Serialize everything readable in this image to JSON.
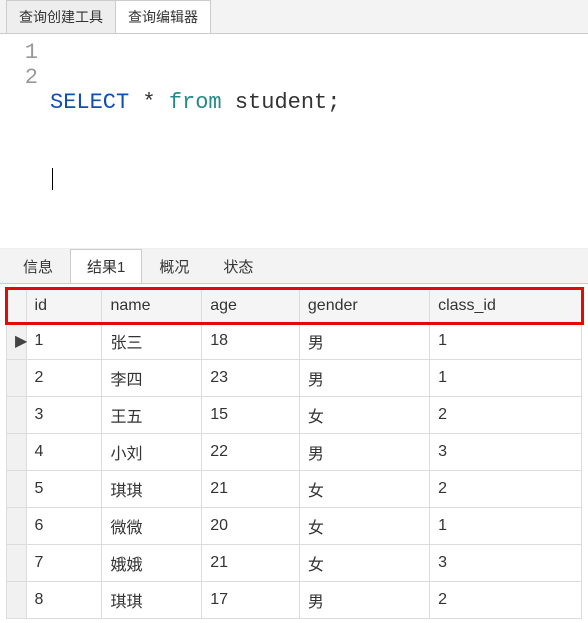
{
  "top_tabs": {
    "create": "查询创建工具",
    "editor": "查询编辑器"
  },
  "code": {
    "line1_num": "1",
    "line2_num": "2",
    "kw_select": "SELECT",
    "star": " * ",
    "kw_from": "from",
    "ident": " student;"
  },
  "result_tabs": {
    "info": "信息",
    "result1": "结果1",
    "profile": "概况",
    "status": "状态"
  },
  "columns": {
    "id": "id",
    "name": "name",
    "age": "age",
    "gender": "gender",
    "class_id": "class_id"
  },
  "rows": [
    {
      "marker": "▶",
      "id": "1",
      "name": "张三",
      "age": "18",
      "gender": "男",
      "class_id": "1"
    },
    {
      "marker": "",
      "id": "2",
      "name": "李四",
      "age": "23",
      "gender": "男",
      "class_id": "1"
    },
    {
      "marker": "",
      "id": "3",
      "name": "王五",
      "age": "15",
      "gender": "女",
      "class_id": "2"
    },
    {
      "marker": "",
      "id": "4",
      "name": "小刘",
      "age": "22",
      "gender": "男",
      "class_id": "3"
    },
    {
      "marker": "",
      "id": "5",
      "name": "琪琪",
      "age": "21",
      "gender": "女",
      "class_id": "2"
    },
    {
      "marker": "",
      "id": "6",
      "name": "微微",
      "age": "20",
      "gender": "女",
      "class_id": "1"
    },
    {
      "marker": "",
      "id": "7",
      "name": "娥娥",
      "age": "21",
      "gender": "女",
      "class_id": "3"
    },
    {
      "marker": "",
      "id": "8",
      "name": "琪琪",
      "age": "17",
      "gender": "男",
      "class_id": "2"
    }
  ]
}
